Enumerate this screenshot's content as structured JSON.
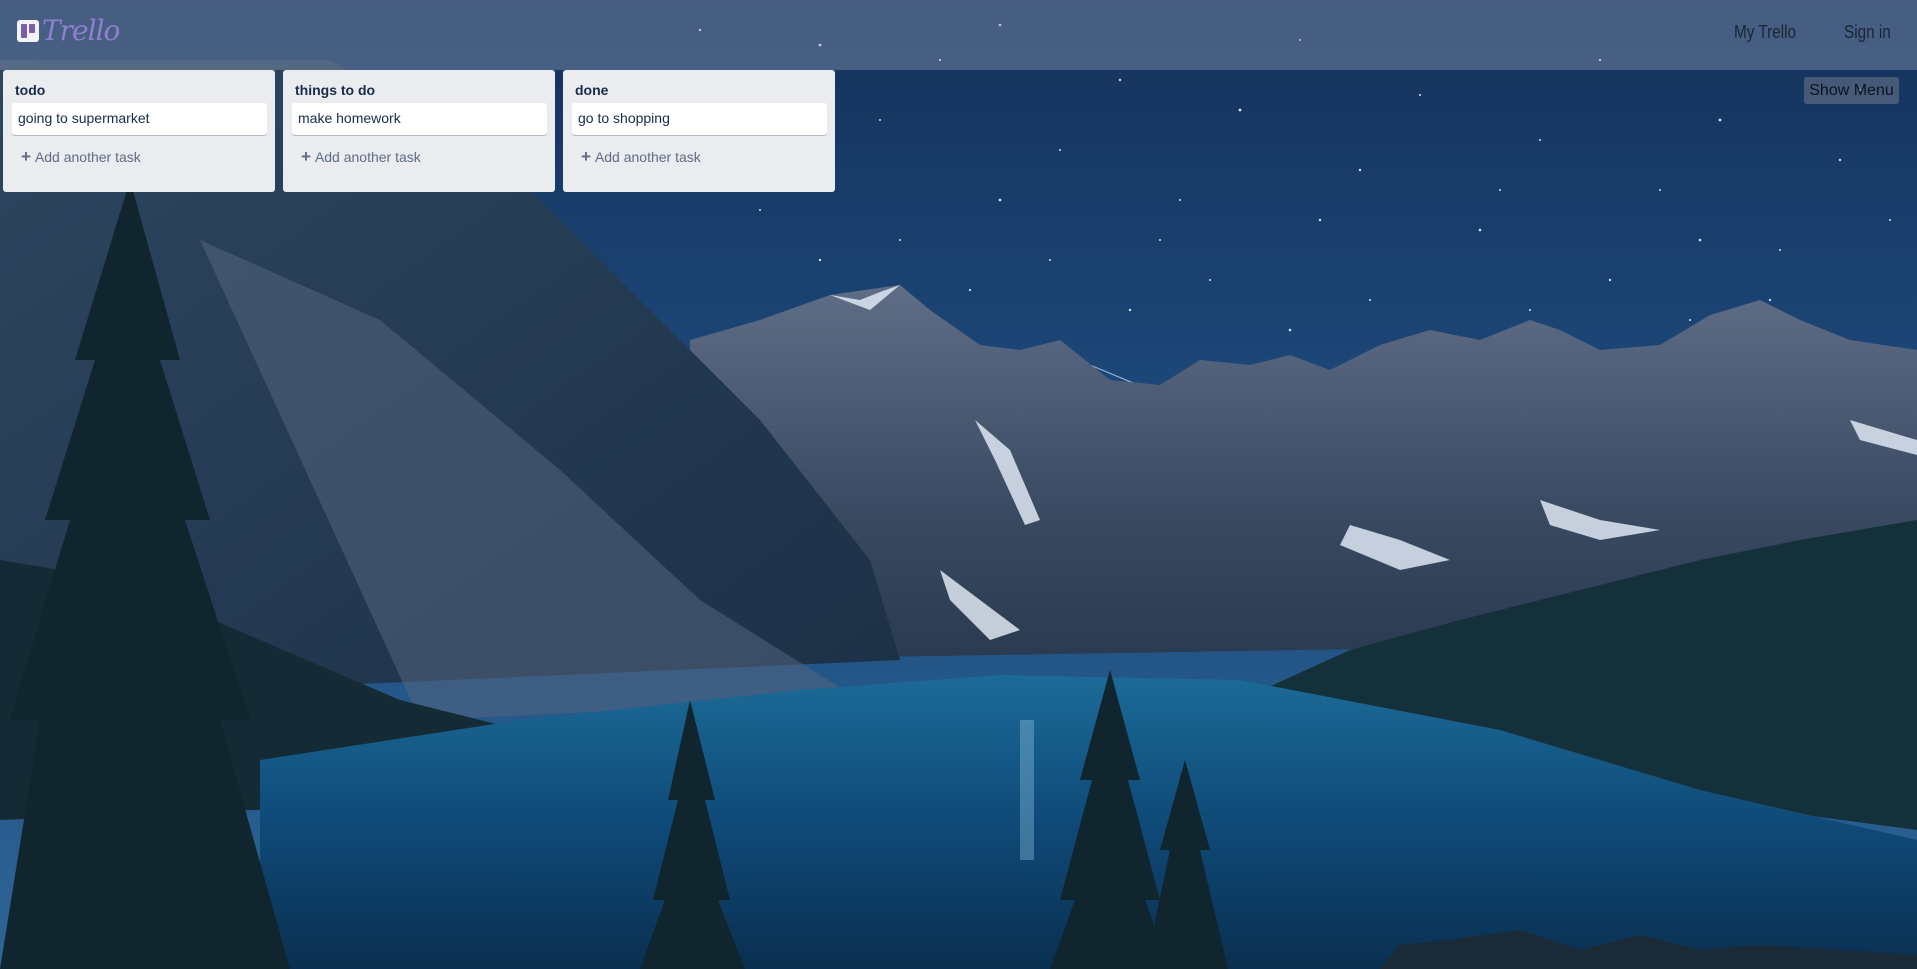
{
  "header": {
    "logo_text": "Trello",
    "nav": {
      "my_trello": "My Trello",
      "sign_in": "Sign in"
    }
  },
  "board": {
    "show_menu_label": "Show Menu",
    "lists": [
      {
        "title": "todo",
        "cards": [
          "going to supermarket"
        ],
        "add_label": "Add another task"
      },
      {
        "title": "things to do",
        "cards": [
          "make homework"
        ],
        "add_label": "Add another task"
      },
      {
        "title": "done",
        "cards": [
          "go to shopping"
        ],
        "add_label": "Add another task"
      }
    ]
  },
  "icons": {
    "logo": "trello-logo-icon",
    "add": "plus-icon"
  },
  "colors": {
    "list_background": "#ebecf0",
    "card_background": "#ffffff",
    "list_title": "#172b4d",
    "add_task_text": "#5e6c84",
    "logo_text": "#8f7fd0",
    "header_overlay": "rgba(150,165,190,0.38)"
  }
}
